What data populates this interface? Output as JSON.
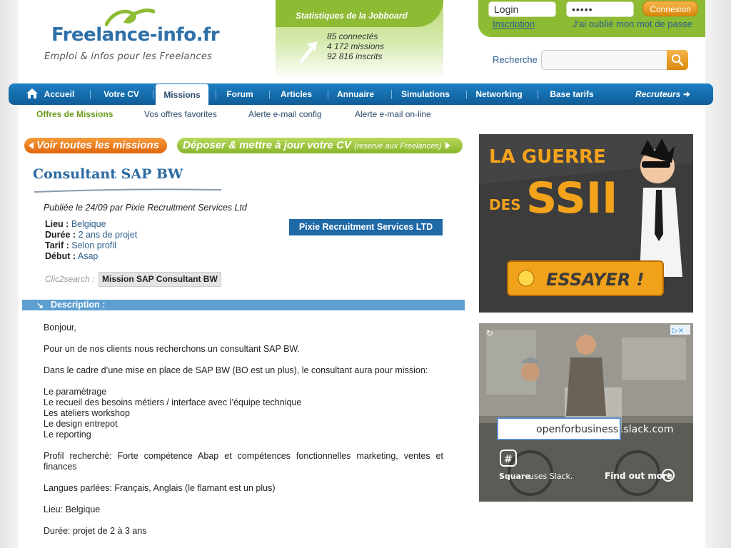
{
  "header": {
    "logo_text": "Freelance-info.fr",
    "tagline": "Emploi & infos pour les Freelances",
    "stats_title": "Statistiques de la Jobboard",
    "stats": [
      "85 connectés",
      "4 172 missions",
      "92 816 inscrits"
    ]
  },
  "login": {
    "login_value": "Login",
    "password_value": "•••••",
    "button_label": "Connexion",
    "register_link": "Inscription",
    "forgot_link": "J'ai oublié mon mot de passe"
  },
  "search": {
    "label": "Recherche",
    "value": ""
  },
  "nav": {
    "items": [
      "Accueil",
      "Votre CV",
      "Missions",
      "Forum",
      "Articles",
      "Annuaire",
      "Simulations",
      "Networking",
      "Base tarifs"
    ],
    "active": "Missions",
    "recruiters": "Recruteurs"
  },
  "subnav": [
    "Offres de Missions",
    "Vos offres favorites",
    "Alerte e-mail config",
    "Alerte e-mail on-line"
  ],
  "buttons": {
    "see_all": "Voir toutes les missions",
    "deposit_cv": "Déposer & mettre à jour votre CV",
    "deposit_cv_note": "(reservé aux Freelances)"
  },
  "job": {
    "title": "Consultant SAP BW",
    "published": "Publiée le 24/09 par Pixie Recruitment Services Ltd",
    "company": "Pixie Recruitment Services LTD",
    "lieu_label": "Lieu :",
    "lieu": "Belgique",
    "duree_label": "Durée :",
    "duree": "2 ans de projet",
    "tarif_label": "Tarif :",
    "tarif": "Selon profil",
    "debut_label": "Début :",
    "debut": "Asap",
    "clic2search_label": "Clic2search :",
    "clic2search_tag": "Mission SAP Consultant BW",
    "description_header": "Description :",
    "description": [
      "Bonjour,",
      "Pour un de nos clients nous recherchons un consultant SAP BW.",
      "Dans le cadre d’une mise en place de SAP BW (BO est un plus), le consultant aura pour mission:",
      "Le paramètrage",
      "Le recueil des besoins métiers / interface avec l’équipe technique",
      "Les ateliers workshop",
      "Le design entrepot",
      "Le reporting",
      "Profil recherché: Forte compétence Abap et compétences fonctionnelles marketing, ventes et finances",
      "Langues parlées: Français, Anglais (le flamant est un plus)",
      "Lieu: Belgique",
      "Durée: projet de 2 à 3 ans"
    ]
  },
  "ads": {
    "ssii_line1": "LA GUERRE",
    "ssii_line2": "DES",
    "ssii_line3": "SSII",
    "ssii_button": "ESSAYER !",
    "slack_input": "openforbusiness",
    "slack_domain": ".slack.com",
    "slack_brand": "Square",
    "slack_brand_note": "uses Slack.",
    "slack_cta": "Find out more"
  },
  "colors": {
    "brand_blue": "#1f6aa6",
    "brand_green": "#8dbb34",
    "orange": "#e2650b"
  }
}
